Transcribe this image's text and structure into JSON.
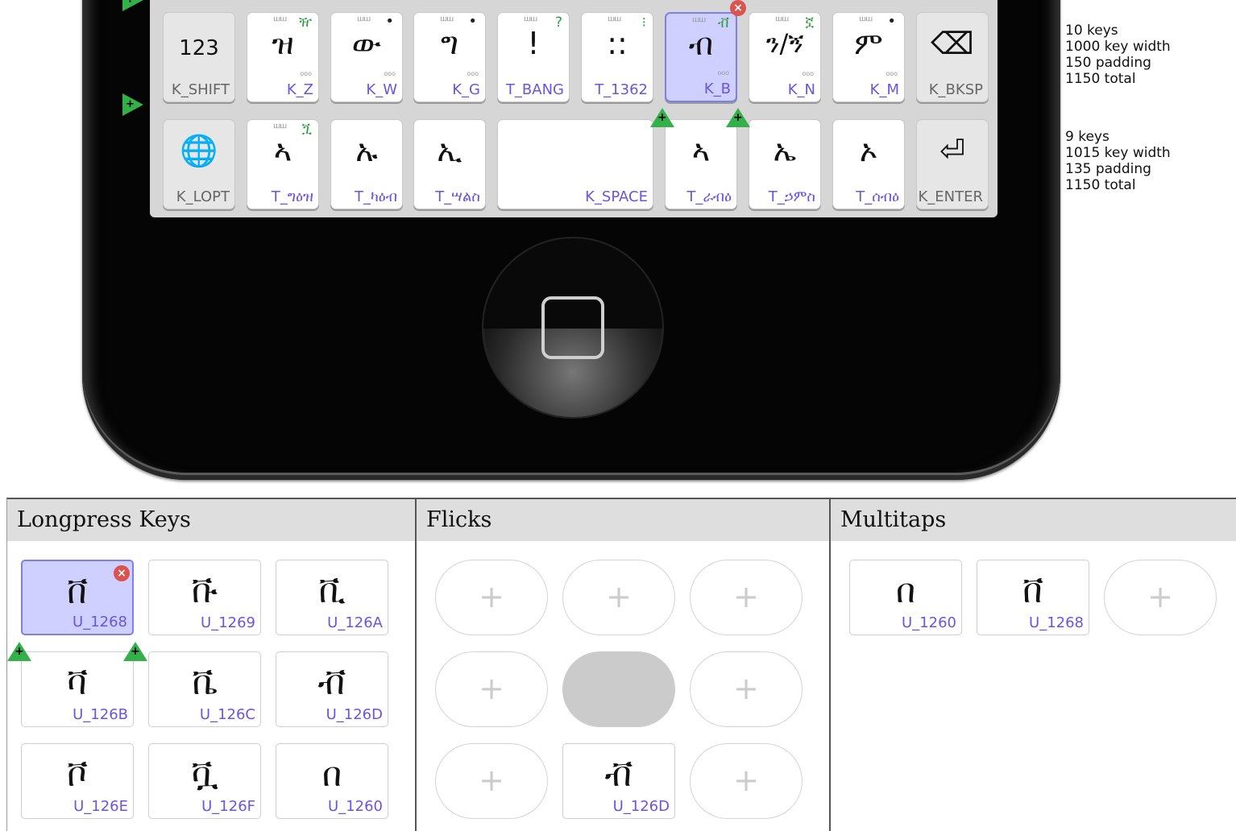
{
  "keyboard": {
    "row1": [
      {
        "cap": "123",
        "id": "K_SHIFT",
        "special": true
      },
      {
        "cap": "ዝ",
        "id": "K_Z",
        "mark": "ꟺꟺ",
        "tr": "ዥ"
      },
      {
        "cap": "ው",
        "id": "K_W",
        "mark": "ꟺꟺ",
        "dot": "•"
      },
      {
        "cap": "ግ",
        "id": "K_G",
        "mark": "ꟺꟺ",
        "dot": "•"
      },
      {
        "cap": "!",
        "id": "T_BANG",
        "mark": "ꟺꟺ",
        "tr": "?"
      },
      {
        "cap": "::",
        "id": "T_1362",
        "mark": "ꟺꟺ",
        "tr": "⁝"
      },
      {
        "cap": "ብ",
        "id": "K_B",
        "mark": "ꟺꟺ",
        "tr": "ቭ",
        "selected": true
      },
      {
        "cap": "ን/ኝ",
        "id": "K_N",
        "mark": "ꟺꟺ",
        "tr": "ኟ"
      },
      {
        "cap": "ም",
        "id": "K_M",
        "mark": "ꟺꟺ",
        "dot": "•"
      },
      {
        "cap": "⌫",
        "id": "K_BKSP",
        "special": true
      }
    ],
    "row2": [
      {
        "cap": "🌐",
        "id": "K_LOPT",
        "special": true
      },
      {
        "cap": "ኣ",
        "id": "T_ግዕዝ",
        "mark": "ꟺꟺ",
        "tr": "ጟ"
      },
      {
        "cap": "ኡ",
        "id": "T_ካዕብ"
      },
      {
        "cap": "ኢ",
        "id": "T_ሣልስ"
      },
      {
        "cap": "",
        "id": "K_SPACE"
      },
      {
        "cap": "ኣ",
        "id": "T_ራብዕ"
      },
      {
        "cap": "ኤ",
        "id": "T_ኃምስ"
      },
      {
        "cap": "ኦ",
        "id": "T_ሰብዕ"
      },
      {
        "cap": "⏎",
        "id": "K_ENTER",
        "special": true
      }
    ]
  },
  "stats": {
    "row1": [
      "10 keys",
      "1000 key width",
      "150 padding",
      "1150 total"
    ],
    "row2": [
      "9 keys",
      "1015 key width",
      "135 padding",
      "1150 total"
    ]
  },
  "panels": {
    "longpress": {
      "title": "Longpress Keys",
      "keys": [
        {
          "cap": "ቨ",
          "id": "U_1268",
          "selected": true
        },
        {
          "cap": "ቩ",
          "id": "U_1269"
        },
        {
          "cap": "ቪ",
          "id": "U_126A"
        },
        {
          "cap": "ቫ",
          "id": "U_126B"
        },
        {
          "cap": "ቬ",
          "id": "U_126C"
        },
        {
          "cap": "ቭ",
          "id": "U_126D"
        },
        {
          "cap": "ቮ",
          "id": "U_126E"
        },
        {
          "cap": "ቯ",
          "id": "U_126F"
        },
        {
          "cap": "በ",
          "id": "U_1260"
        }
      ]
    },
    "flicks": {
      "title": "Flicks",
      "plus": "+",
      "filled": {
        "cap": "ቭ",
        "id": "U_126D"
      }
    },
    "multitaps": {
      "title": "Multitaps",
      "plus": "+",
      "keys": [
        {
          "cap": "በ",
          "id": "U_1260"
        },
        {
          "cap": "ቨ",
          "id": "U_1268"
        }
      ]
    }
  },
  "icons": {
    "delete": "×",
    "add": "+",
    "row_add": "+"
  },
  "colors": {
    "accent": "#6a55e0",
    "selected_bg": "#cfd0ff",
    "add_green": "#33b04a",
    "delete_red": "#d9534f"
  }
}
